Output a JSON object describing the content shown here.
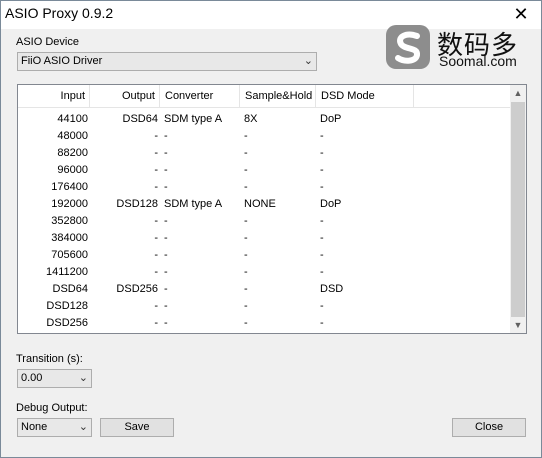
{
  "window": {
    "title": "ASIO Proxy 0.9.2",
    "close_glyph": "✕"
  },
  "watermark": {
    "cn_text": "数码多",
    "en_text": "Soomal.com"
  },
  "device": {
    "label": "ASIO Device",
    "selected": "FiiO ASIO Driver"
  },
  "table": {
    "columns": [
      "Input",
      "Output",
      "Converter",
      "Sample&Hold",
      "DSD Mode"
    ],
    "rows": [
      [
        "44100",
        "DSD64",
        "SDM type A",
        "8X",
        "DoP"
      ],
      [
        "48000",
        "-",
        "-",
        "-",
        "-"
      ],
      [
        "88200",
        "-",
        "-",
        "-",
        "-"
      ],
      [
        "96000",
        "-",
        "-",
        "-",
        "-"
      ],
      [
        "176400",
        "-",
        "-",
        "-",
        "-"
      ],
      [
        "192000",
        "DSD128",
        "SDM type A",
        "NONE",
        "DoP"
      ],
      [
        "352800",
        "-",
        "-",
        "-",
        "-"
      ],
      [
        "384000",
        "-",
        "-",
        "-",
        "-"
      ],
      [
        "705600",
        "-",
        "-",
        "-",
        "-"
      ],
      [
        "1411200",
        "-",
        "-",
        "-",
        "-"
      ],
      [
        "DSD64",
        "DSD256",
        "-",
        "-",
        "DSD"
      ],
      [
        "DSD128",
        "-",
        "-",
        "-",
        "-"
      ],
      [
        "DSD256",
        "-",
        "-",
        "-",
        "-"
      ]
    ]
  },
  "transition": {
    "label": "Transition (s):",
    "selected": "0.00"
  },
  "debug": {
    "label": "Debug Output:",
    "selected": "None"
  },
  "buttons": {
    "save": "Save",
    "close": "Close"
  }
}
